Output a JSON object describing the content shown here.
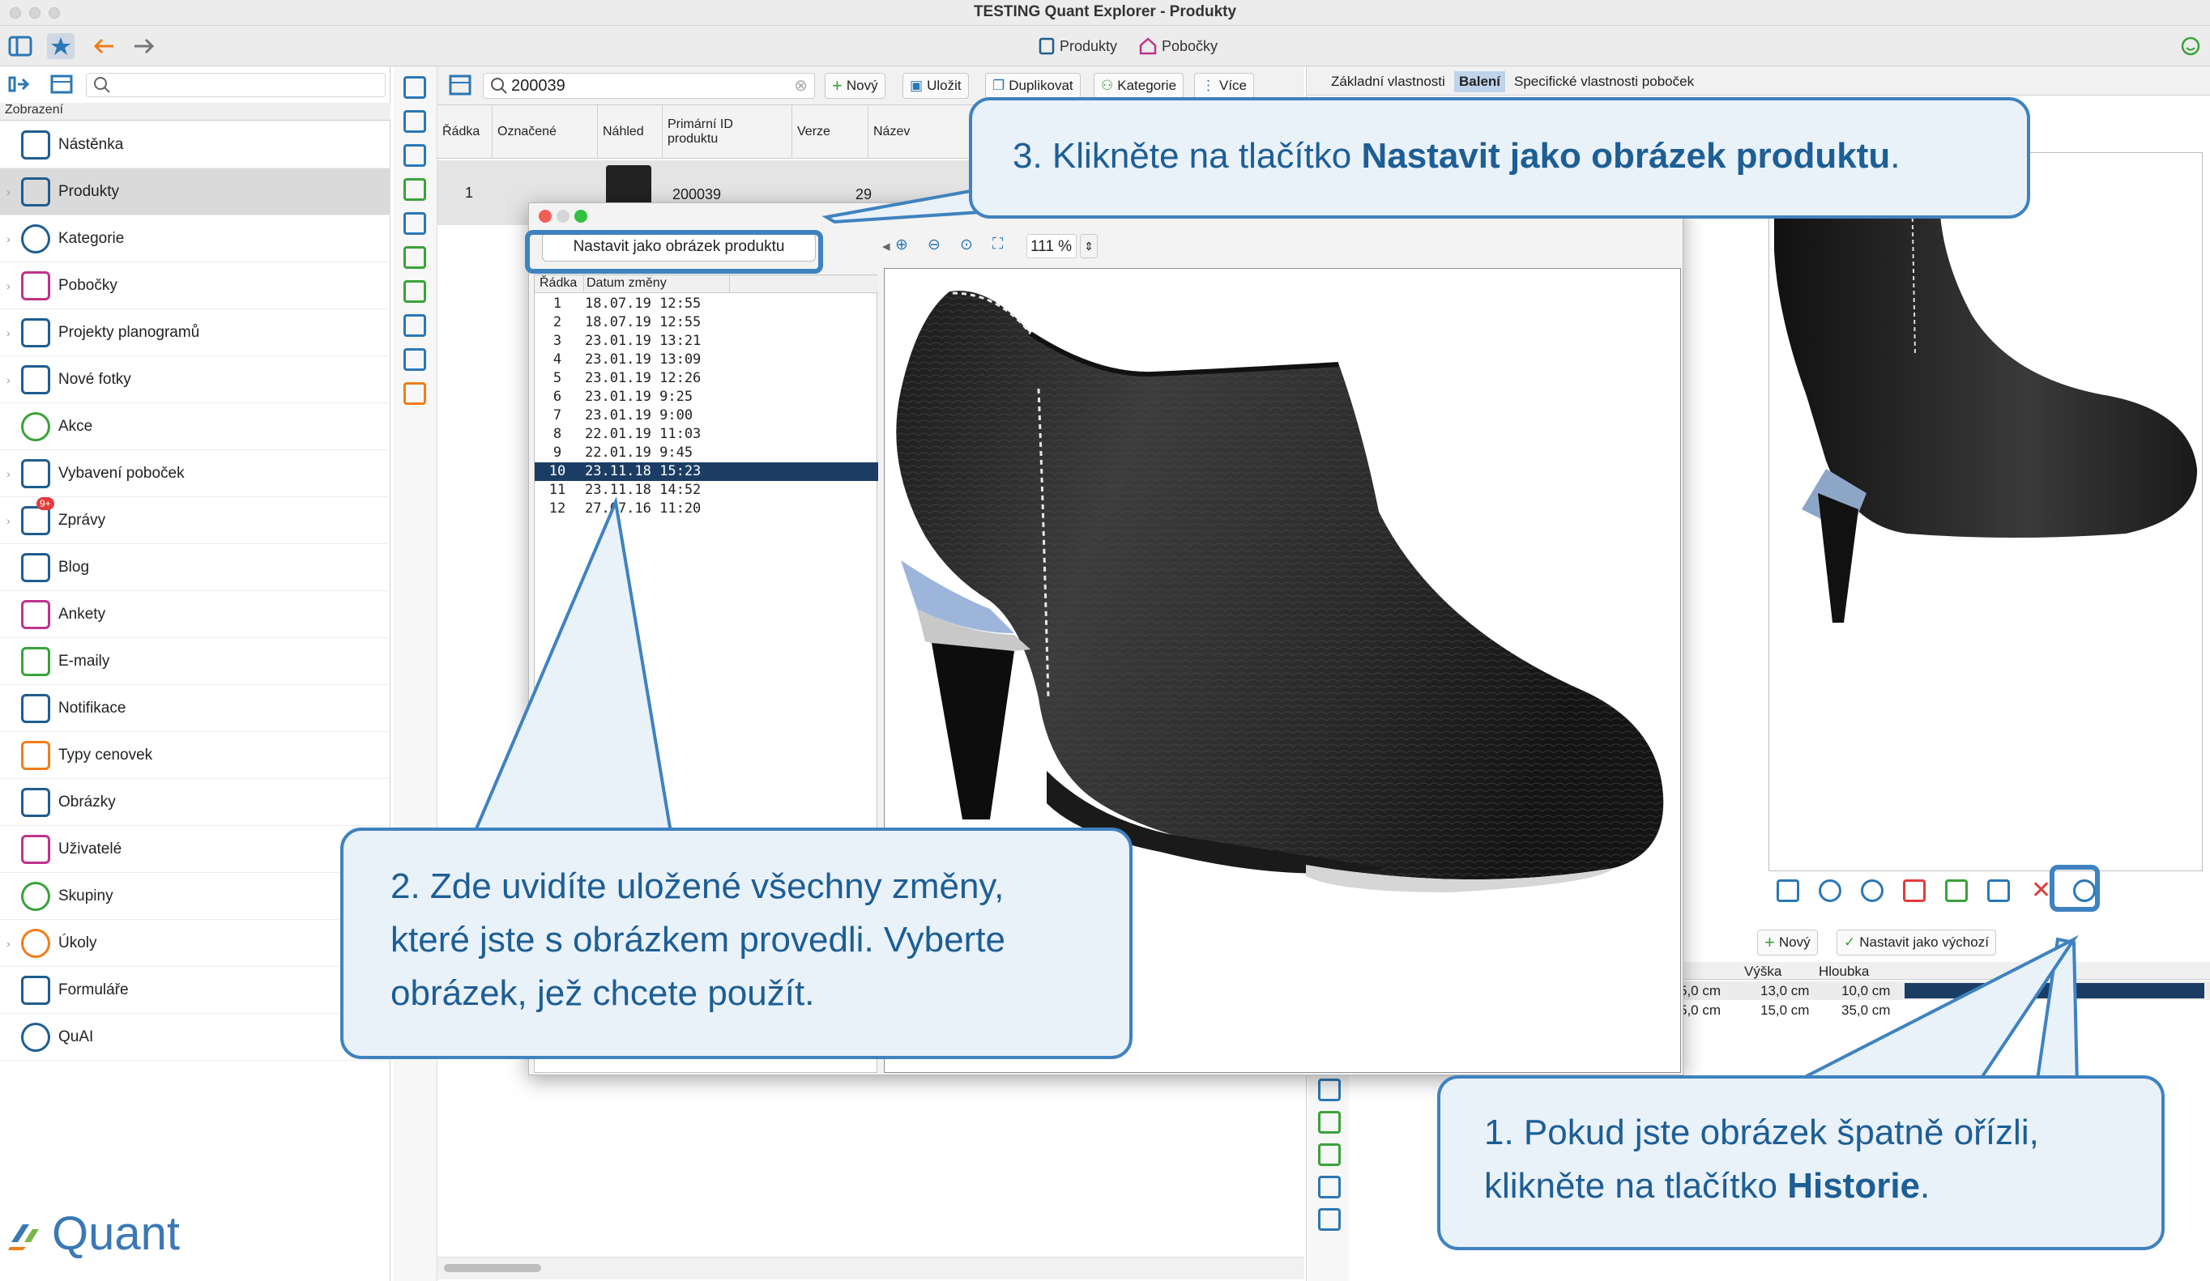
{
  "window": {
    "title": "TESTING Quant Explorer - Produkty"
  },
  "top_tabs": [
    {
      "label": "Produkty"
    },
    {
      "label": "Pobočky"
    }
  ],
  "sidebar": {
    "header": "Zobrazení",
    "items": [
      {
        "label": "Nástěnka"
      },
      {
        "label": "Produkty"
      },
      {
        "label": "Kategorie"
      },
      {
        "label": "Pobočky"
      },
      {
        "label": "Projekty planogramů"
      },
      {
        "label": "Nové fotky"
      },
      {
        "label": "Akce"
      },
      {
        "label": "Vybavení poboček"
      },
      {
        "label": "Zprávy",
        "badge": "9+"
      },
      {
        "label": "Blog"
      },
      {
        "label": "Ankety"
      },
      {
        "label": "E-maily"
      },
      {
        "label": "Notifikace"
      },
      {
        "label": "Typy cenovek"
      },
      {
        "label": "Obrázky"
      },
      {
        "label": "Uživatelé"
      },
      {
        "label": "Skupiny"
      },
      {
        "label": "Úkoly"
      },
      {
        "label": "Formuláře"
      },
      {
        "label": "QuAI"
      }
    ],
    "logo": "Quant"
  },
  "grid": {
    "search_value": "200039",
    "buttons": {
      "new": "Nový",
      "save": "Uložit",
      "duplicate": "Duplikovat",
      "category": "Kategorie",
      "more": "Více"
    },
    "columns": [
      "Řádka",
      "Označené",
      "Náhled",
      "Primární ID produktu",
      "Verze",
      "Název"
    ],
    "row": {
      "index": "1",
      "primary_id": "200039",
      "version": "29"
    }
  },
  "dialog": {
    "set_button": "Nastavit jako obrázek produktu",
    "list_headers": [
      "Řádka",
      "Datum změny"
    ],
    "rows": [
      {
        "n": "1",
        "d": "18.07.19 12:55"
      },
      {
        "n": "2",
        "d": "18.07.19 12:55"
      },
      {
        "n": "3",
        "d": "23.01.19 13:21"
      },
      {
        "n": "4",
        "d": "23.01.19 13:09"
      },
      {
        "n": "5",
        "d": "23.01.19 12:26"
      },
      {
        "n": "6",
        "d": "23.01.19 9:25"
      },
      {
        "n": "7",
        "d": "23.01.19 9:00"
      },
      {
        "n": "8",
        "d": "22.01.19 11:03"
      },
      {
        "n": "9",
        "d": "22.01.19 9:45"
      },
      {
        "n": "10",
        "d": "23.11.18 15:23"
      },
      {
        "n": "11",
        "d": "23.11.18 14:52"
      },
      {
        "n": "12",
        "d": "27.07.16 11:20"
      }
    ],
    "selected_row": 10,
    "zoom": "111 %"
  },
  "right_panel": {
    "tabs": [
      "Základní vlastnosti",
      "Balení",
      "Specifické vlastnosti poboček"
    ],
    "active_tab": "Balení",
    "buttons": {
      "new": "Nový",
      "set_default": "Nastavit jako výchozí"
    },
    "dim_headers": [
      "Výška",
      "Hloubka"
    ],
    "dim_rows": [
      {
        "w": "5,0 cm",
        "h": "13,0 cm",
        "d": "10,0 cm"
      },
      {
        "w": "5,0 cm",
        "h": "15,0 cm",
        "d": "35,0 cm"
      }
    ]
  },
  "callouts": {
    "c1_pre": "1.  Pokud jste obrázek špatně ořízli,",
    "c1_line2": "klikněte na tlačítko ",
    "c1_bold": "Historie",
    "c1_post": ".",
    "c2_line1": "2.  Zde uvidíte uložené všechny změny,",
    "c2_line2": "které jste s obrázkem provedli. Vyberte",
    "c2_line3": "obrázek, jež chcete použít.",
    "c3_pre": "3. Klikněte na tlačítko ",
    "c3_bold": "Nastavit jako obrázek produktu",
    "c3_post": "."
  },
  "colors": {
    "accent": "#3f82bf",
    "selection": "#1c3d63",
    "icon": "#1f5d8f"
  }
}
